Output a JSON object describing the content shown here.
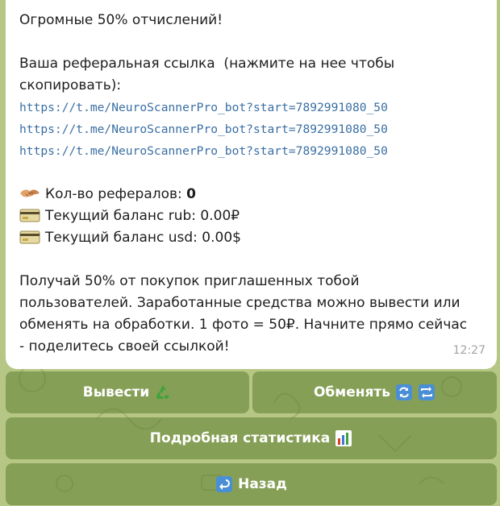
{
  "message": {
    "heading": "Огромные 50% отчислений!",
    "referral_intro_line1": "Ваша реферальная ссылка  (нажмите на нее чтобы",
    "referral_intro_line2": "скопировать):",
    "links": [
      "https://t.me/NeuroScannerPro_bot?start=7892991080_50",
      "https://t.me/NeuroScannerPro_bot?start=7892991080_50",
      "https://t.me/NeuroScannerPro_bot?start=7892991080_50"
    ],
    "referrals_label": "Кол-во рефералов: ",
    "referrals_value": "0",
    "balance_rub": "Текущий баланс rub: 0.00₽",
    "balance_usd": "Текущий баланс usd: 0.00$",
    "footer_line1": "Получай 50% от покупок приглашенных тобой",
    "footer_line2": "пользователей. Заработанные средства можно вывести или",
    "footer_line3": "обменять на обработки. 1 фото = 50₽. Начните прямо сейчас",
    "footer_line4": "- поделитесь своей ссылкой!",
    "time": "12:27",
    "icons": [
      "handshake-icon",
      "credit-card-icon",
      "credit-card-icon"
    ]
  },
  "keyboard": {
    "withdraw_label": "Вывести",
    "withdraw_icon": "recycle-icon",
    "exchange_label": "Обменять",
    "exchange_icons": [
      "refresh-icon",
      "repeat-icon"
    ],
    "stats_label": "Подробная статистика",
    "stats_icon": "bar-chart-icon",
    "back_label": "Назад",
    "back_icon": "return-arrow-icon"
  },
  "colors": {
    "chat_background": "#b6c785",
    "bubble": "#ffffff",
    "link": "#3a6fa3",
    "button_background": "#7f9a4f",
    "timestamp": "#a3a3a3"
  }
}
